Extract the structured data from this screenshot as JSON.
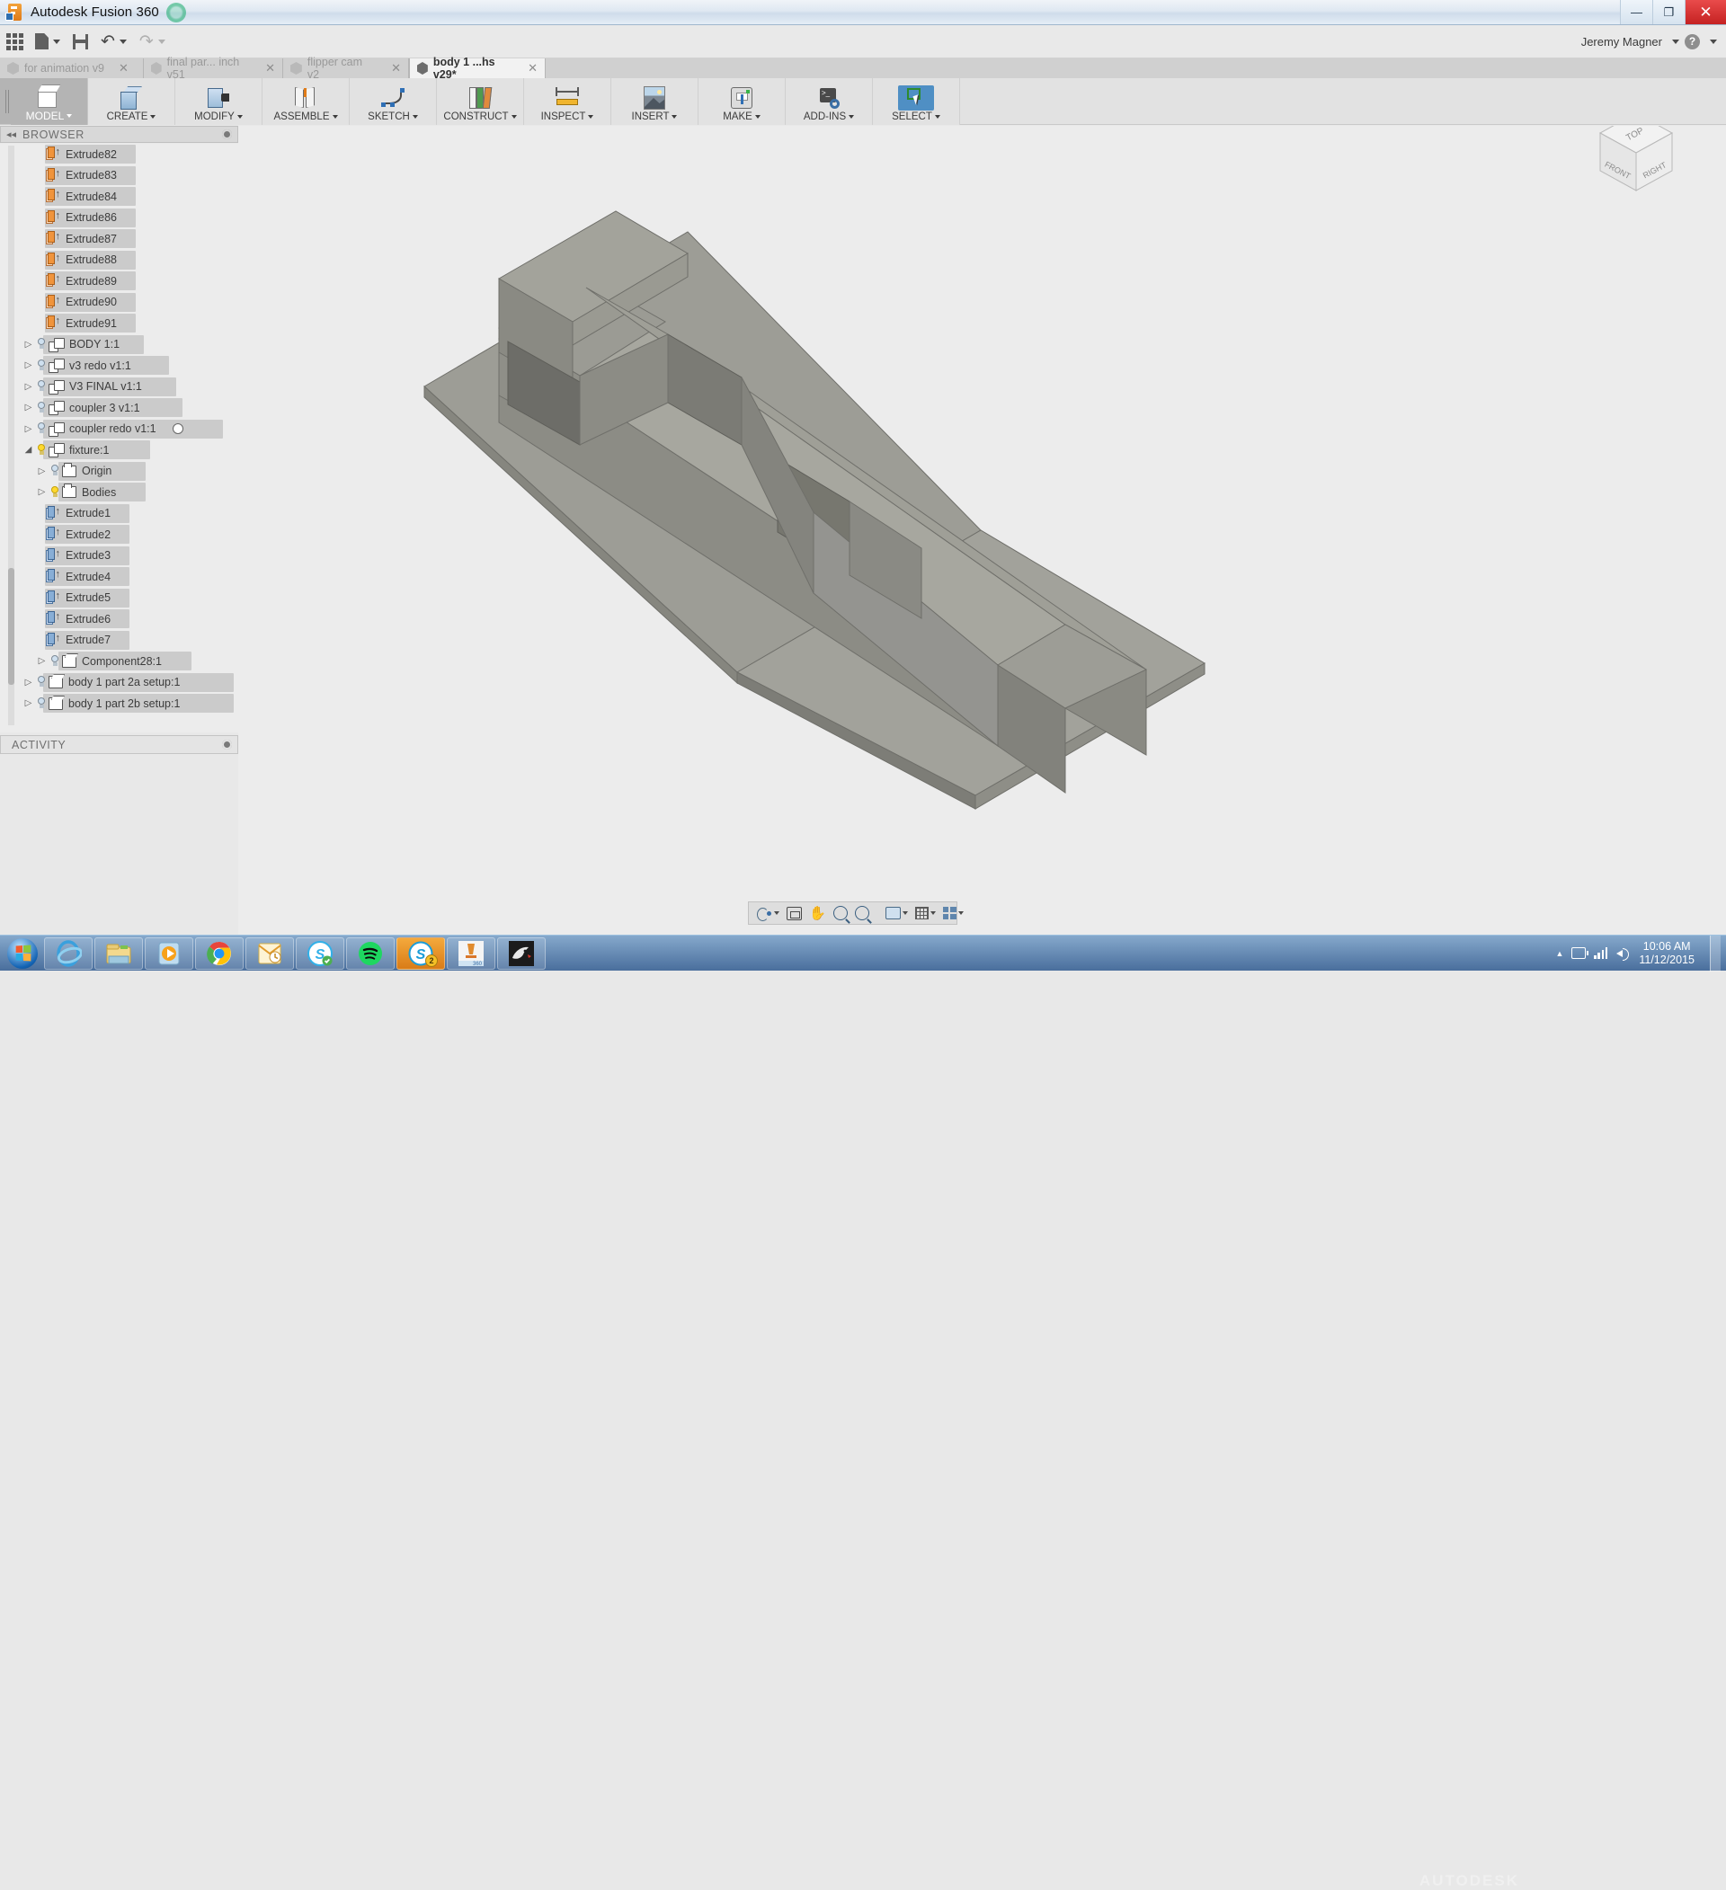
{
  "window": {
    "title": "Autodesk Fusion 360",
    "app_icon": "fusion360-logo-icon",
    "buttons": {
      "minimize": "—",
      "maximize": "❐",
      "close": "✕"
    }
  },
  "quick_access": {
    "items": [
      {
        "name": "app-grid-button",
        "icon": "grid-icon",
        "label": ""
      },
      {
        "name": "new-document-button",
        "icon": "document-icon",
        "label": "",
        "has_caret": true
      },
      {
        "name": "save-button",
        "icon": "save-disk-icon",
        "label": ""
      },
      {
        "name": "undo-button",
        "icon": "undo-arrow-icon",
        "label": "",
        "has_caret": true
      },
      {
        "name": "redo-button",
        "icon": "redo-arrow-icon",
        "label": "",
        "has_caret": true,
        "disabled": true
      }
    ],
    "account_name": "Jeremy Magner",
    "help_label": "?"
  },
  "doc_tabs": [
    {
      "label": "for animation v9",
      "active": false,
      "close": "✕"
    },
    {
      "label": "final par... inch v51",
      "active": false,
      "close": "✕"
    },
    {
      "label": "flipper cam v2",
      "active": false,
      "close": "✕"
    },
    {
      "label": "body 1 ...hs v29*",
      "active": true,
      "close": "✕"
    }
  ],
  "ribbon": {
    "workspace": {
      "label": "MODEL",
      "icon": "model-cube-icon",
      "has_caret": true
    },
    "tabs": [
      {
        "label": "CREATE",
        "icon": "create-box-icon",
        "has_caret": true
      },
      {
        "label": "MODIFY",
        "icon": "modify-press-pull-icon",
        "has_caret": true
      },
      {
        "label": "ASSEMBLE",
        "icon": "assemble-joint-icon",
        "has_caret": true
      },
      {
        "label": "SKETCH",
        "icon": "sketch-spline-icon",
        "has_caret": true
      },
      {
        "label": "CONSTRUCT",
        "icon": "construct-plane-icon",
        "has_caret": true
      },
      {
        "label": "INSPECT",
        "icon": "inspect-measure-icon",
        "has_caret": true
      },
      {
        "label": "INSERT",
        "icon": "insert-image-icon",
        "has_caret": true
      },
      {
        "label": "MAKE",
        "icon": "make-3d-print-icon",
        "has_caret": true
      },
      {
        "label": "ADD-INS",
        "icon": "add-ins-script-icon",
        "has_caret": true
      },
      {
        "label": "SELECT",
        "icon": "select-window-icon",
        "has_caret": true,
        "selected": true
      }
    ]
  },
  "browser": {
    "header_label": "BROWSER",
    "collapse_icon": "collapse-left-icon",
    "options_icon": "panel-options-icon",
    "tree": [
      {
        "label": "Extrude82",
        "type": "feature",
        "icon": "extrude-orange-icon",
        "indent": 3
      },
      {
        "label": "Extrude83",
        "type": "feature",
        "icon": "extrude-orange-icon",
        "indent": 3
      },
      {
        "label": "Extrude84",
        "type": "feature",
        "icon": "extrude-orange-icon",
        "indent": 3
      },
      {
        "label": "Extrude86",
        "type": "feature",
        "icon": "extrude-orange-icon",
        "indent": 3
      },
      {
        "label": "Extrude87",
        "type": "feature",
        "icon": "extrude-orange-icon",
        "indent": 3
      },
      {
        "label": "Extrude88",
        "type": "feature",
        "icon": "extrude-orange-icon",
        "indent": 3
      },
      {
        "label": "Extrude89",
        "type": "feature",
        "icon": "extrude-orange-icon",
        "indent": 3
      },
      {
        "label": "Extrude90",
        "type": "feature",
        "icon": "extrude-orange-icon",
        "indent": 3
      },
      {
        "label": "Extrude91",
        "type": "feature",
        "icon": "extrude-orange-icon",
        "indent": 3
      },
      {
        "label": "BODY 1:1",
        "type": "component",
        "icon": "component-icon",
        "indent": 1,
        "expander": "▷",
        "bulb": "off"
      },
      {
        "label": "v3 redo v1:1",
        "type": "component",
        "icon": "component-icon",
        "indent": 1,
        "expander": "▷",
        "bulb": "off"
      },
      {
        "label": "V3 FINAL v1:1",
        "type": "component",
        "icon": "component-icon",
        "indent": 1,
        "expander": "▷",
        "bulb": "off"
      },
      {
        "label": "coupler 3 v1:1",
        "type": "component",
        "icon": "component-icon",
        "indent": 1,
        "expander": "▷",
        "bulb": "off"
      },
      {
        "label": "coupler redo v1:1",
        "type": "component",
        "icon": "component-icon",
        "indent": 1,
        "expander": "▷",
        "bulb": "off",
        "trailing_icon": "circle-marker-icon"
      },
      {
        "label": "fixture:1",
        "type": "component",
        "icon": "component-icon",
        "indent": 1,
        "expander": "◢",
        "bulb": "on"
      },
      {
        "label": "Origin",
        "type": "folder",
        "icon": "folder-icon",
        "indent": 2,
        "expander": "▷",
        "bulb": "off"
      },
      {
        "label": "Bodies",
        "type": "folder",
        "icon": "folder-icon",
        "indent": 2,
        "expander": "▷",
        "bulb": "on"
      },
      {
        "label": "Extrude1",
        "type": "feature",
        "icon": "extrude-blue-icon",
        "indent": 3
      },
      {
        "label": "Extrude2",
        "type": "feature",
        "icon": "extrude-blue-icon",
        "indent": 3
      },
      {
        "label": "Extrude3",
        "type": "feature",
        "icon": "extrude-blue-icon",
        "indent": 3
      },
      {
        "label": "Extrude4",
        "type": "feature",
        "icon": "extrude-blue-icon",
        "indent": 3
      },
      {
        "label": "Extrude5",
        "type": "feature",
        "icon": "extrude-blue-icon",
        "indent": 3
      },
      {
        "label": "Extrude6",
        "type": "feature",
        "icon": "extrude-blue-icon",
        "indent": 3
      },
      {
        "label": "Extrude7",
        "type": "feature",
        "icon": "extrude-blue-icon",
        "indent": 3
      },
      {
        "label": "Component28:1",
        "type": "body",
        "icon": "body-cube-icon",
        "indent": 2,
        "expander": "▷",
        "bulb": "off"
      },
      {
        "label": "body 1 part 2a setup:1",
        "type": "body",
        "icon": "body-cube-icon",
        "indent": 1,
        "expander": "▷",
        "bulb": "off"
      },
      {
        "label": "body 1 part 2b setup:1",
        "type": "body",
        "icon": "body-cube-icon",
        "indent": 1,
        "expander": "▷",
        "bulb": "off"
      }
    ]
  },
  "activity": {
    "label": "ACTIVITY",
    "options_icon": "panel-options-icon"
  },
  "viewcube": {
    "top": "TOP",
    "front": "FRONT",
    "right": "RIGHT"
  },
  "navbar": {
    "items": [
      {
        "name": "orbit-button",
        "icon": "orbit-icon",
        "has_caret": true
      },
      {
        "name": "look-at-button",
        "icon": "look-at-icon",
        "has_caret": false
      },
      {
        "name": "pan-button",
        "icon": "pan-hand-icon",
        "has_caret": false
      },
      {
        "name": "zoom-button",
        "icon": "zoom-icon",
        "has_caret": false
      },
      {
        "name": "fit-button",
        "icon": "zoom-fit-icon",
        "has_caret": false
      },
      {
        "name": "display-settings-button",
        "icon": "display-monitor-icon",
        "has_caret": true
      },
      {
        "name": "grid-snaps-button",
        "icon": "grid-icon",
        "has_caret": true
      },
      {
        "name": "viewports-button",
        "icon": "viewports-quad-icon",
        "has_caret": true
      }
    ]
  },
  "taskbar": {
    "start_icon": "windows-start-orb-icon",
    "items": [
      {
        "name": "taskbar-internet-explorer",
        "icon": "internet-explorer-icon"
      },
      {
        "name": "taskbar-file-explorer",
        "icon": "file-explorer-icon"
      },
      {
        "name": "taskbar-media-player",
        "icon": "windows-media-player-icon"
      },
      {
        "name": "taskbar-chrome",
        "icon": "google-chrome-icon"
      },
      {
        "name": "taskbar-outlook",
        "icon": "microsoft-outlook-icon"
      },
      {
        "name": "taskbar-skype",
        "icon": "skype-icon",
        "badge": ""
      },
      {
        "name": "taskbar-spotify",
        "icon": "spotify-icon"
      },
      {
        "name": "taskbar-skype-business",
        "icon": "skype-business-icon",
        "badge": "2",
        "active": true
      },
      {
        "name": "taskbar-fusion360",
        "icon": "fusion-360-icon",
        "label": "360"
      },
      {
        "name": "taskbar-rhino",
        "icon": "rhinoceros-3d-icon"
      }
    ],
    "tray": {
      "show_hidden_icon": "chevron-up-icon",
      "battery_icon": "battery-icon",
      "network_icon": "wifi-signal-icon",
      "volume_icon": "speaker-icon",
      "time": "10:06 AM",
      "date": "11/12/2015"
    },
    "watermark": "AUTODESK"
  }
}
